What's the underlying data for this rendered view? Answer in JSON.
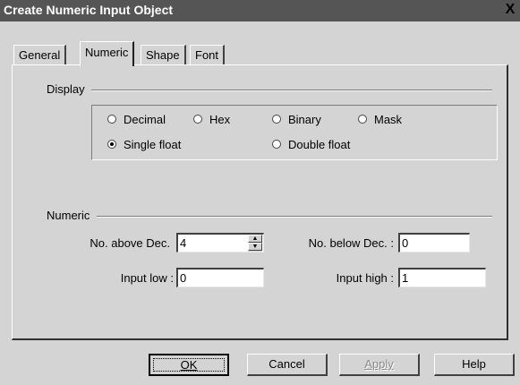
{
  "window": {
    "title": "Create Numeric Input Object",
    "close_glyph": "X"
  },
  "tabs": [
    {
      "label": "General",
      "active": false
    },
    {
      "label": "Numeric",
      "active": true
    },
    {
      "label": "Shape",
      "active": false
    },
    {
      "label": "Font",
      "active": false
    }
  ],
  "display": {
    "group_label": "Display",
    "options": [
      {
        "label": "Decimal",
        "checked": false
      },
      {
        "label": "Hex",
        "checked": false
      },
      {
        "label": "Binary",
        "checked": false
      },
      {
        "label": "Mask",
        "checked": false
      },
      {
        "label": "Single float",
        "checked": true
      },
      {
        "label": "Double float",
        "checked": false
      }
    ]
  },
  "numeric": {
    "group_label": "Numeric",
    "above_dec_label": "No. above Dec.",
    "above_dec_value": "4",
    "below_dec_label": "No. below Dec. :",
    "below_dec_value": "0",
    "input_low_label": "Input low :",
    "input_low_value": "0",
    "input_high_label": "Input high :",
    "input_high_value": "1"
  },
  "buttons": {
    "ok": "OK",
    "cancel": "Cancel",
    "apply": "Apply",
    "help": "Help"
  }
}
